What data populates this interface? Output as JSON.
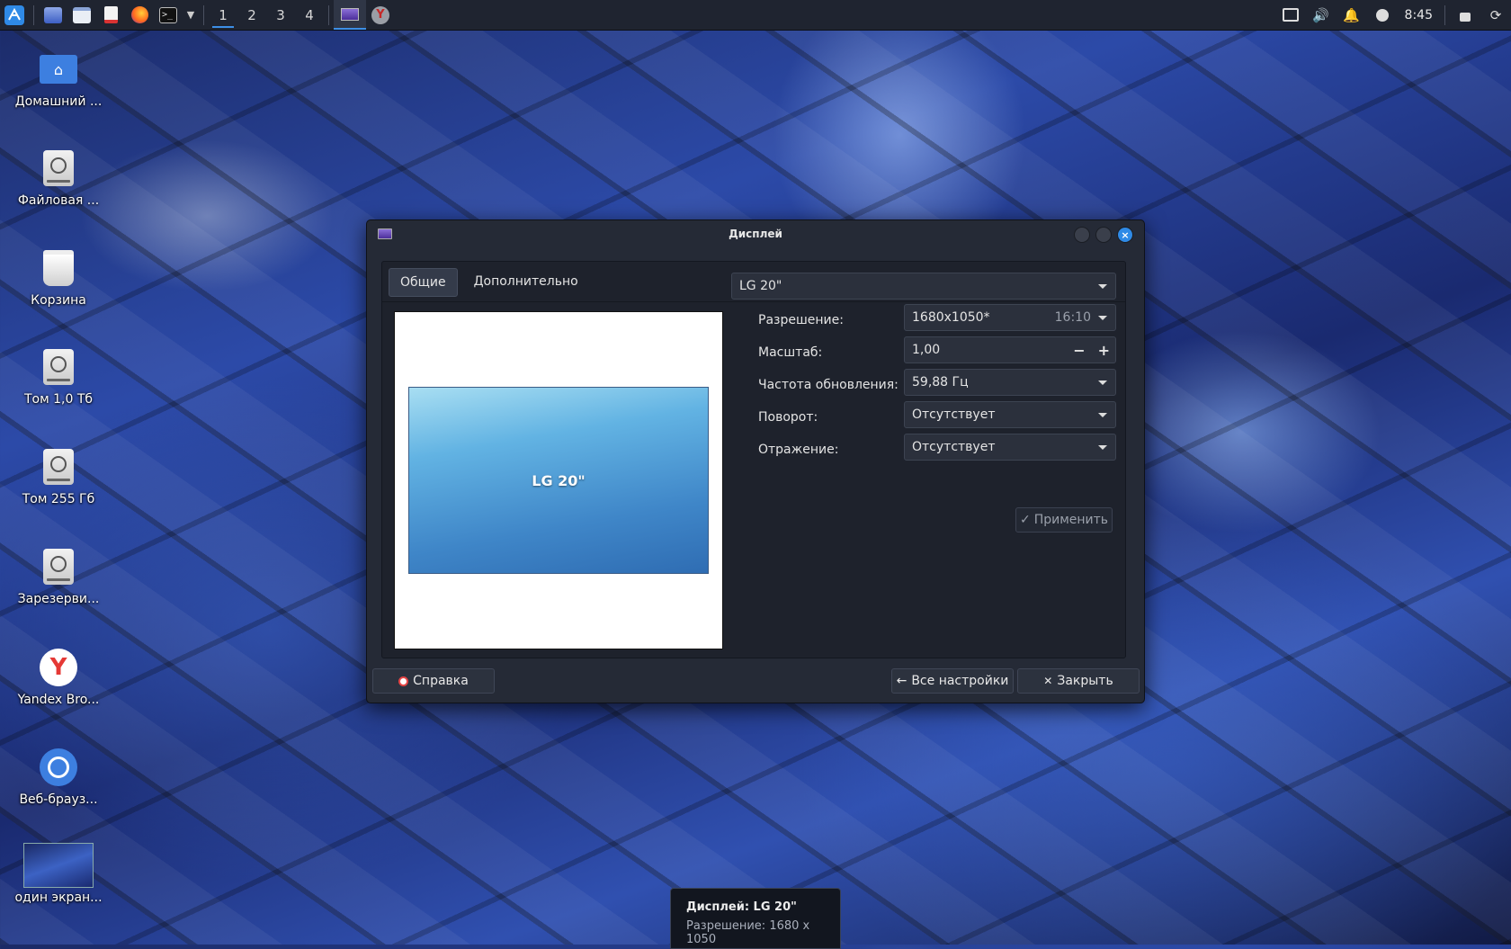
{
  "taskbar": {
    "workspaces": [
      "1",
      "2",
      "3",
      "4"
    ],
    "active_workspace": "1",
    "clock": "8:45",
    "launchers": [
      "menu-icon",
      "desktop-icon",
      "file-manager-icon",
      "text-editor-icon",
      "firefox-icon",
      "terminal-icon"
    ],
    "tray": [
      "screen-icon",
      "volume-icon",
      "bell-icon",
      "power-icon",
      "lock-icon",
      "refresh-icon"
    ]
  },
  "desktop": {
    "icons": [
      {
        "label": "Домашний ...",
        "icon": "home-folder-icon"
      },
      {
        "label": "Файловая ...",
        "icon": "filesystem-drive-icon"
      },
      {
        "label": "Корзина",
        "icon": "trash-icon"
      },
      {
        "label": "Том 1,0 Тб",
        "icon": "drive-icon"
      },
      {
        "label": "Том 255 Гб",
        "icon": "drive-icon"
      },
      {
        "label": "Зарезерви...",
        "icon": "drive-icon"
      },
      {
        "label": "Yandex Bro...",
        "icon": "yandex-browser-icon"
      },
      {
        "label": "Веб-брауз...",
        "icon": "web-browser-icon"
      },
      {
        "label": "один экран...",
        "icon": "image-thumbnail-icon"
      }
    ]
  },
  "dialog": {
    "title": "Дисплей",
    "tabs": [
      "Общие",
      "Дополнительно"
    ],
    "active_tab": "Общие",
    "monitor_label": "LG 20\"",
    "display_select": "LG 20\"",
    "fields": {
      "resolution": {
        "label": "Разрешение:",
        "value": "1680x1050*",
        "ratio": "16:10"
      },
      "scale": {
        "label": "Масштаб:",
        "value": "1,00",
        "minus": "−",
        "plus": "+"
      },
      "refresh": {
        "label": "Частота обновления:",
        "value": "59,88 Гц"
      },
      "rotation": {
        "label": "Поворот:",
        "value": "Отсутствует"
      },
      "reflection": {
        "label": "Отражение:",
        "value": "Отсутствует"
      }
    },
    "apply_label": "Применить",
    "help_label": "Справка",
    "all_settings_label": "Все настройки",
    "close_label": "Закрыть"
  },
  "notification": {
    "title": "Дисплей: LG 20\"",
    "body": "Разрешение: 1680 x 1050"
  },
  "colors": {
    "accent": "#3d8fe6",
    "panel_bg": "#1f2430",
    "dialog_bg": "#252a36"
  }
}
